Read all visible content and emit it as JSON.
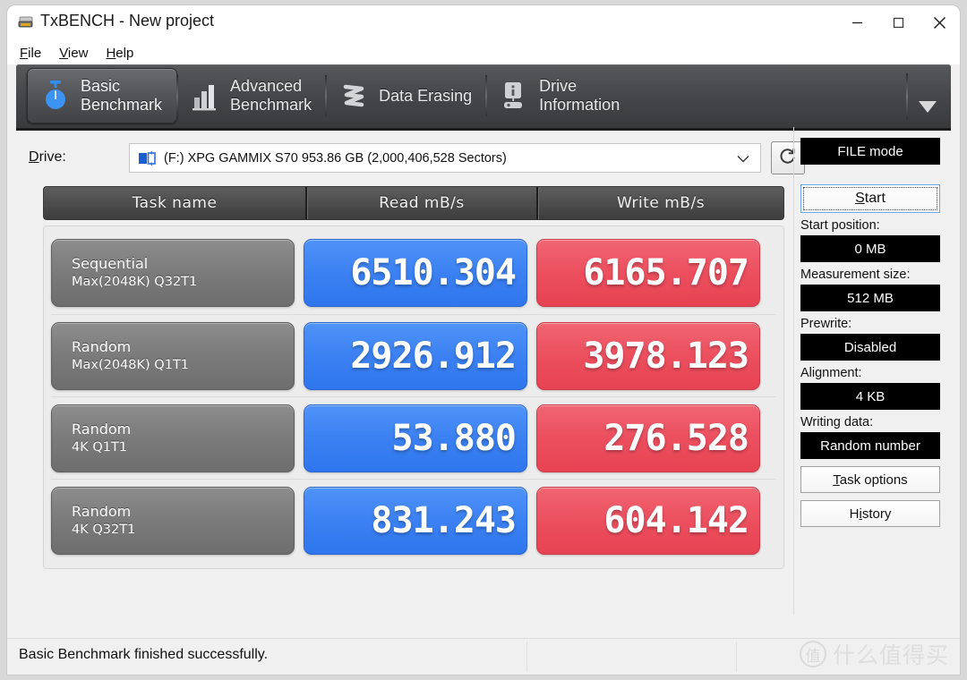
{
  "window": {
    "title": "TxBENCH - New project",
    "icon": "app-drive-icon",
    "minimize": "minimize-icon",
    "maximize": "maximize-icon",
    "close": "close-icon"
  },
  "menu": {
    "items": [
      {
        "label": "File",
        "accel": "F"
      },
      {
        "label": "View",
        "accel": "V"
      },
      {
        "label": "Help",
        "accel": "H"
      }
    ]
  },
  "tabs": {
    "items": [
      {
        "label": "Basic\nBenchmark",
        "icon": "stopwatch-icon",
        "active": true
      },
      {
        "label": "Advanced\nBenchmark",
        "icon": "bar-chart-icon",
        "active": false
      },
      {
        "label": "Data Erasing",
        "icon": "shredder-icon",
        "active": false
      },
      {
        "label": "Drive\nInformation",
        "icon": "drive-info-icon",
        "active": false
      }
    ],
    "overflow_icon": "chevron-down-icon"
  },
  "drive": {
    "label": "Drive:",
    "accel": "D",
    "value": "(F:) XPG GAMMIX S70  953.86 GB (2,000,406,528 Sectors)",
    "icon": "drive-icon",
    "dropdown_icon": "chevron-down-icon",
    "refresh_icon": "refresh-icon"
  },
  "results": {
    "headers": [
      "Task name",
      "Read mB/s",
      "Write mB/s"
    ],
    "rows": [
      {
        "name_line1": "Sequential",
        "name_line2": "Max(2048K) Q32T1",
        "read": "6510.304",
        "write": "6165.707"
      },
      {
        "name_line1": "Random",
        "name_line2": "Max(2048K) Q1T1",
        "read": "2926.912",
        "write": "3978.123"
      },
      {
        "name_line1": "Random",
        "name_line2": "4K Q1T1",
        "read": "53.880",
        "write": "276.528"
      },
      {
        "name_line1": "Random",
        "name_line2": "4K Q32T1",
        "read": "831.243",
        "write": "604.142"
      }
    ]
  },
  "sidepanel": {
    "mode_button": "FILE mode",
    "start_button": "Start",
    "start_accel": "S",
    "start_position_label": "Start position:",
    "start_position_value": "0 MB",
    "measurement_size_label": "Measurement size:",
    "measurement_size_value": "512 MB",
    "prewrite_label": "Prewrite:",
    "prewrite_value": "Disabled",
    "alignment_label": "Alignment:",
    "alignment_value": "4 KB",
    "writing_data_label": "Writing data:",
    "writing_data_value": "Random number",
    "task_options_button": "Task options",
    "task_options_accel": "T",
    "history_button": "History",
    "history_accel": "i"
  },
  "statusbar": {
    "message": "Basic Benchmark finished successfully."
  },
  "watermark": {
    "badge": "值",
    "text": "什么值得买"
  },
  "colors": {
    "read": "#3b81f2",
    "write": "#ec4f5e",
    "task": "#7c7c7c",
    "tabstrip": "#46474a",
    "accent_focus": "#6ea8dc"
  }
}
